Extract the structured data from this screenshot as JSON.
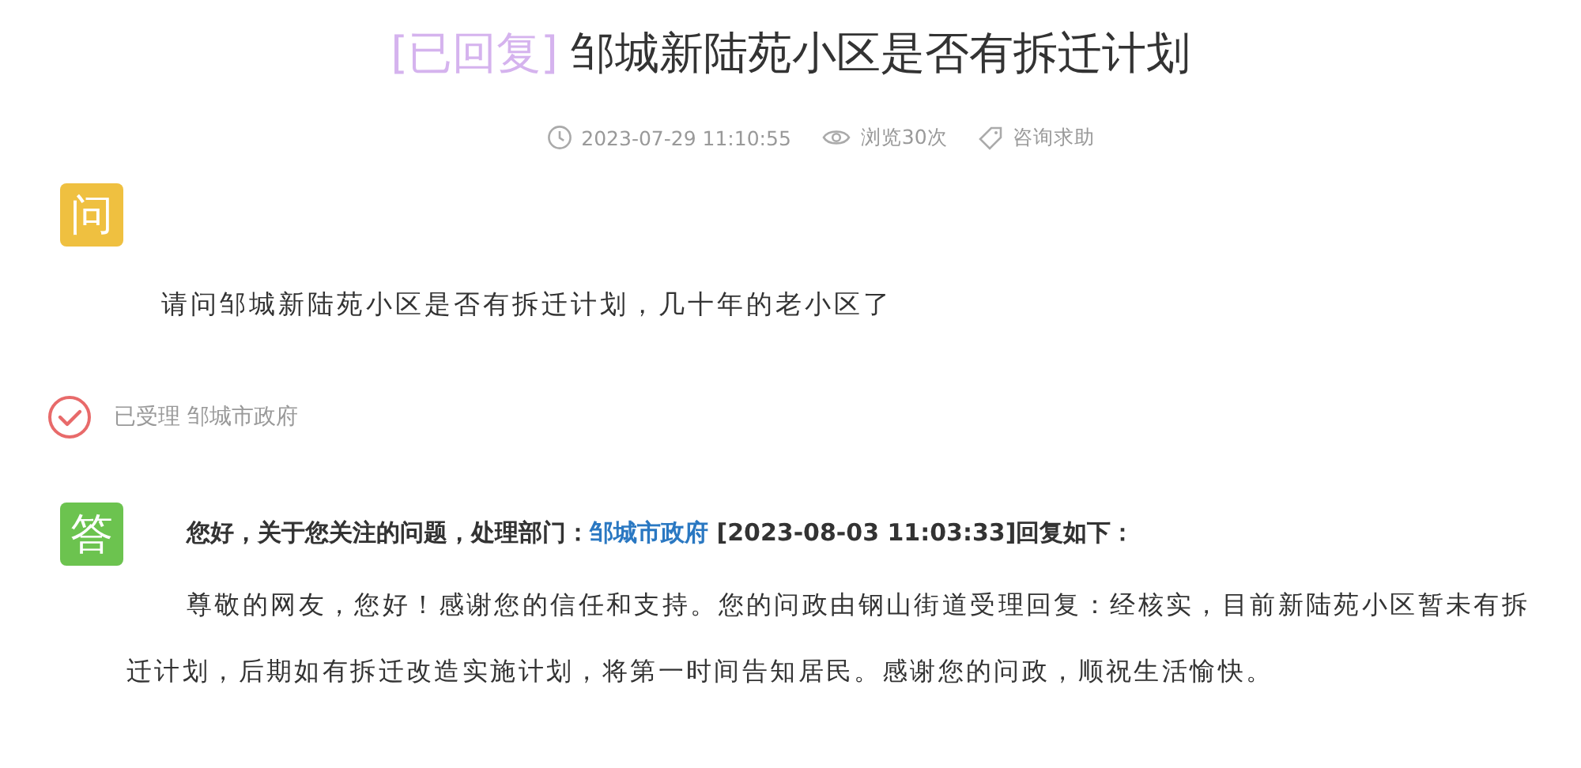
{
  "title": {
    "status": "[已回复]",
    "text": "邹城新陆苑小区是否有拆迁计划"
  },
  "meta": {
    "time": "2023-07-29 11:10:55",
    "views": "浏览30次",
    "category": "咨询求助"
  },
  "question": {
    "badge": "问",
    "text": "请问邹城新陆苑小区是否有拆迁计划，几十年的老小区了"
  },
  "status": {
    "state": "已受理",
    "department": "邹城市政府"
  },
  "answer": {
    "badge": "答",
    "heading_before": "您好，关于您关注的问题，处理部门：",
    "department": "邹城市政府",
    "heading_after": " [2023-08-03 11:03:33]回复如下：",
    "body": "尊敬的网友，您好！感谢您的信任和支持。您的问政由钢山街道受理回复：经核实，目前新陆苑小区暂未有拆迁计划，后期如有拆迁改造实施计划，将第一时间告知居民。感谢您的问政，顺祝生活愉快。"
  }
}
